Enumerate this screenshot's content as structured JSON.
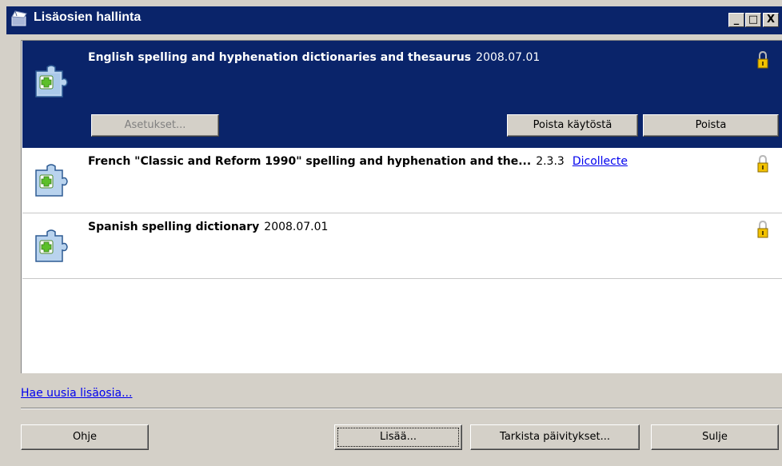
{
  "window": {
    "title": "Lisäosien hallinta",
    "controls": {
      "minimize": "_",
      "maximize": "□",
      "close": "X"
    }
  },
  "extensions": [
    {
      "name": "English spelling and hyphenation dictionaries and thesaurus",
      "version": "2008.07.01",
      "link": "",
      "selected": true,
      "icon": "puzzle-piece-icon",
      "buttons": {
        "options": "Asetukset...",
        "disable": "Poista käytöstä",
        "remove": "Poista"
      }
    },
    {
      "name": "French \"Classic and Reform 1990\" spelling and hyphenation and the...",
      "version": "2.3.3",
      "link": "Dicollecte",
      "selected": false,
      "icon": "puzzle-piece-icon"
    },
    {
      "name": "Spanish spelling dictionary",
      "version": "2008.07.01",
      "link": "",
      "selected": false,
      "icon": "puzzle-piece-icon"
    }
  ],
  "get_more_link": "Hae uusia lisäosia...",
  "footer": {
    "help": "Ohje",
    "add": "Lisää...",
    "check_updates": "Tarkista päivitykset...",
    "close": "Sulje"
  },
  "colors": {
    "selection": "#0a246a",
    "link": "#0000ee",
    "face": "#d4d0c8"
  }
}
